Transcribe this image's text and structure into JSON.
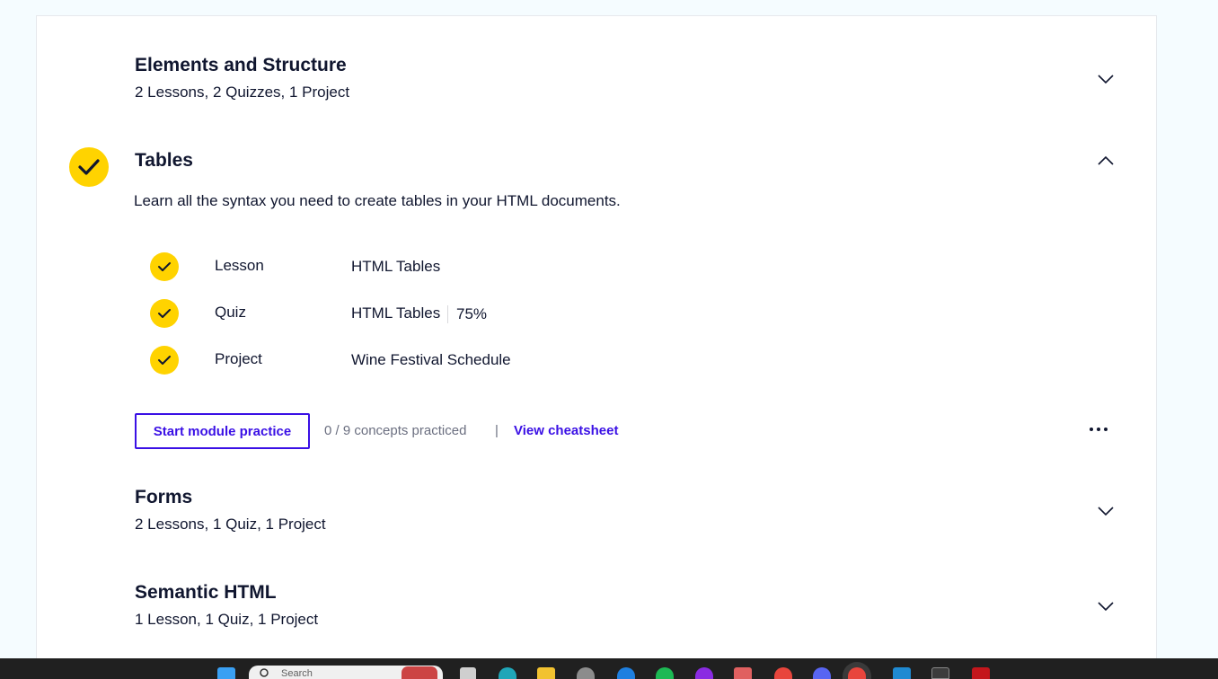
{
  "modules": [
    {
      "title": "Elements and Structure",
      "subtitle": "2 Lessons, 2 Quizzes, 1 Project",
      "expanded": false,
      "completed": false
    },
    {
      "title": "Tables",
      "description": "Learn all the syntax you need to create tables in your HTML documents.",
      "expanded": true,
      "completed": true,
      "items": [
        {
          "type": "Lesson",
          "name": "HTML Tables",
          "completed": true
        },
        {
          "type": "Quiz",
          "name": "HTML Tables",
          "score": "75%",
          "completed": true
        },
        {
          "type": "Project",
          "name": "Wine Festival Schedule",
          "completed": true
        }
      ],
      "practice_button": "Start module practice",
      "concepts_text": "0 / 9 concepts practiced",
      "separator": "|",
      "cheatsheet_link": "View cheatsheet"
    },
    {
      "title": "Forms",
      "subtitle": "2 Lessons, 1 Quiz, 1 Project",
      "expanded": false,
      "completed": false
    },
    {
      "title": "Semantic HTML",
      "subtitle": "1 Lesson, 1 Quiz, 1 Project",
      "expanded": false,
      "completed": false
    }
  ],
  "taskbar": {
    "search_placeholder": "Search",
    "icons": [
      "windows-start-icon",
      "search-icon",
      "task-view-icon",
      "edge-icon",
      "file-explorer-icon",
      "settings-icon",
      "app-icon",
      "spotify-icon",
      "app-icon",
      "paint-icon",
      "chrome-icon",
      "discord-icon",
      "chrome-profile-icon",
      "vscode-icon",
      "terminal-icon",
      "app-icon"
    ]
  },
  "colors": {
    "accent": "#3a10e5",
    "check": "#ffd300",
    "text": "#10162f",
    "muted": "#6b6f80",
    "page_bg": "#f5fcff"
  }
}
